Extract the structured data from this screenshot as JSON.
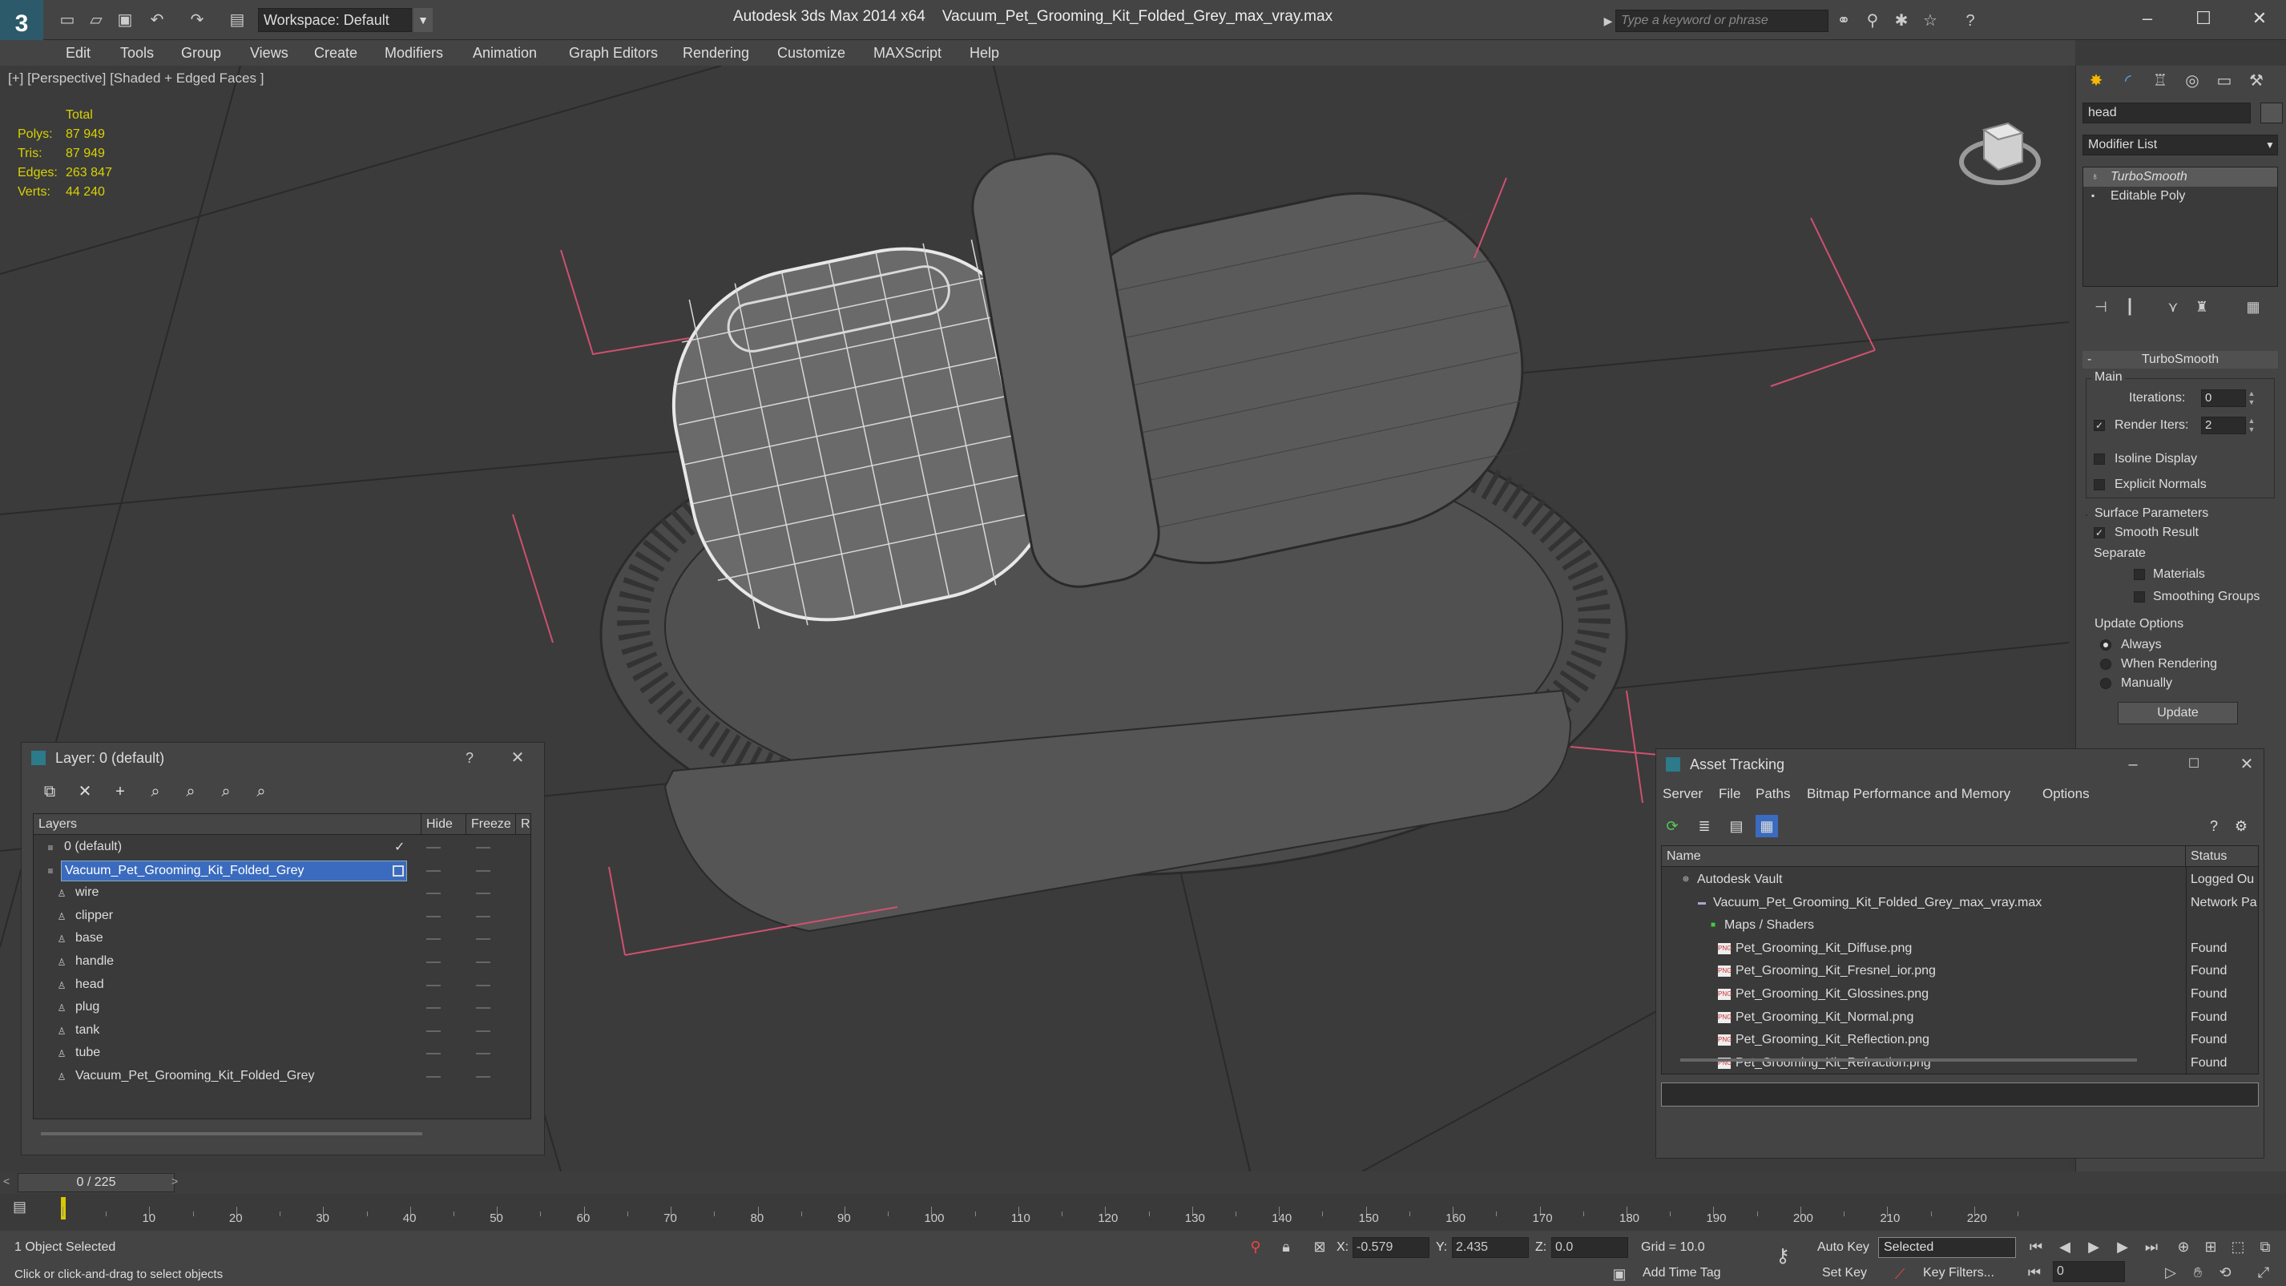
{
  "app": {
    "title": "Autodesk 3ds Max  2014 x64",
    "file": "Vacuum_Pet_Grooming_Kit_Folded_Grey_max_vray.max",
    "workspace": "Workspace: Default",
    "search_placeholder": "Type a keyword or phrase"
  },
  "menu": [
    "Edit",
    "Tools",
    "Group",
    "Views",
    "Create",
    "Modifiers",
    "Animation",
    "Graph Editors",
    "Rendering",
    "Customize",
    "MAXScript",
    "Help"
  ],
  "viewport": {
    "label": "[+] [Perspective] [Shaded + Edged Faces ]",
    "stats": {
      "header": "Total",
      "rows": [
        {
          "label": "Polys:",
          "value": "87 949"
        },
        {
          "label": "Tris:",
          "value": "87 949"
        },
        {
          "label": "Edges:",
          "value": "263 847"
        },
        {
          "label": "Verts:",
          "value": "44 240"
        }
      ]
    }
  },
  "command_panel": {
    "object_name": "head",
    "modifier_list": "Modifier List",
    "stack": [
      "TurboSmooth",
      "Editable Poly"
    ],
    "rollout": "TurboSmooth",
    "main": "Main",
    "iterations_label": "Iterations:",
    "iterations": "0",
    "render_iters_label": "Render Iters:",
    "render_iters": "2",
    "isoline": "Isoline Display",
    "explicit_normals": "Explicit Normals",
    "surface_params": "Surface Parameters",
    "smooth_result": "Smooth Result",
    "separate": "Separate",
    "materials": "Materials",
    "smoothing_groups": "Smoothing Groups",
    "update_options": "Update Options",
    "always": "Always",
    "when_rendering": "When Rendering",
    "manually": "Manually",
    "update_button": "Update"
  },
  "layer_window": {
    "title": "Layer: 0 (default)",
    "help": "?",
    "columns": [
      "Layers",
      "Hide",
      "Freeze",
      "R"
    ],
    "rows": [
      {
        "name": "0 (default)",
        "level": 0
      },
      {
        "name": "Vacuum_Pet_Grooming_Kit_Folded_Grey",
        "level": 0
      },
      {
        "name": "wire",
        "level": 1
      },
      {
        "name": "clipper",
        "level": 1
      },
      {
        "name": "base",
        "level": 1
      },
      {
        "name": "handle",
        "level": 1
      },
      {
        "name": "head",
        "level": 1
      },
      {
        "name": "plug",
        "level": 1
      },
      {
        "name": "tank",
        "level": 1
      },
      {
        "name": "tube",
        "level": 1
      },
      {
        "name": "Vacuum_Pet_Grooming_Kit_Folded_Grey",
        "level": 1
      }
    ]
  },
  "asset_window": {
    "title": "Asset Tracking",
    "menu": [
      "Server",
      "File",
      "Paths",
      "Bitmap Performance and Memory",
      "Options"
    ],
    "columns": [
      "Name",
      "Status"
    ],
    "rows": [
      {
        "name": "Autodesk Vault",
        "status": "Logged Ou",
        "level": 1
      },
      {
        "name": "Vacuum_Pet_Grooming_Kit_Folded_Grey_max_vray.max",
        "status": "Network Pa",
        "level": 2
      },
      {
        "name": "Maps / Shaders",
        "status": "",
        "level": 3
      },
      {
        "name": "Pet_Grooming_Kit_Diffuse.png",
        "status": "Found",
        "level": 4
      },
      {
        "name": "Pet_Grooming_Kit_Fresnel_ior.png",
        "status": "Found",
        "level": 4
      },
      {
        "name": "Pet_Grooming_Kit_Glossines.png",
        "status": "Found",
        "level": 4
      },
      {
        "name": "Pet_Grooming_Kit_Normal.png",
        "status": "Found",
        "level": 4
      },
      {
        "name": "Pet_Grooming_Kit_Reflection.png",
        "status": "Found",
        "level": 4
      },
      {
        "name": "Pet_Grooming_Kit_Refraction.png",
        "status": "Found",
        "level": 4
      }
    ]
  },
  "timeline": {
    "frame": "0 / 225",
    "ticks": [
      "10",
      "20",
      "30",
      "40",
      "50",
      "60",
      "70",
      "80",
      "90",
      "100",
      "110",
      "120",
      "130",
      "140",
      "150",
      "160",
      "170",
      "180",
      "190",
      "200",
      "210",
      "220"
    ]
  },
  "status": {
    "selected": "1 Object Selected",
    "hint": "Click or click-and-drag to select objects",
    "x_label": "X:",
    "x": "-0.579",
    "y_label": "Y:",
    "y": "2.435",
    "z_label": "Z:",
    "z": "0.0",
    "grid": "Grid = 10.0",
    "auto_key": "Auto Key",
    "set_key": "Set Key",
    "selected_dd": "Selected",
    "key_filters": "Key Filters...",
    "add_time_tag": "Add Time Tag",
    "frame_field": "0"
  },
  "colors": {
    "accent": "#3a6bbf",
    "stats": "#d8d200",
    "selection_box": "#d05070"
  }
}
